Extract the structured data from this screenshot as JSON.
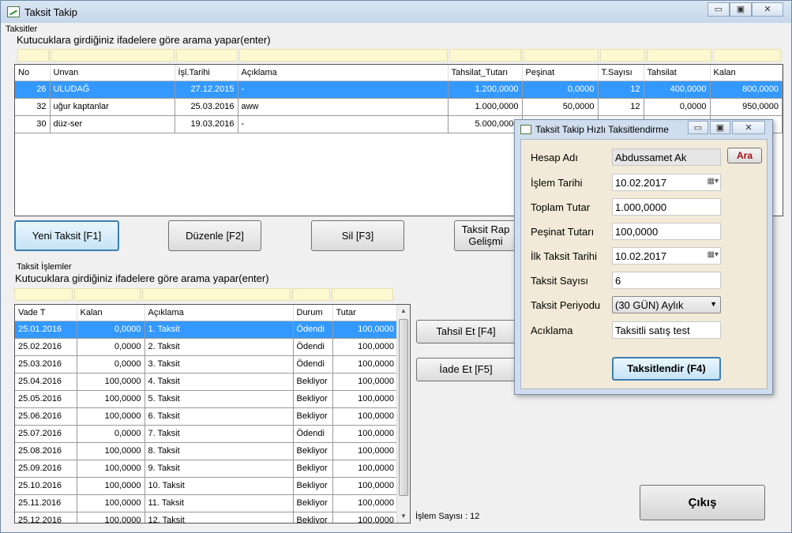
{
  "window": {
    "title": "Taksit Takip",
    "min": "▭",
    "max": "▣",
    "close": "✕"
  },
  "top": {
    "group_label": "Taksitler",
    "hint": "Kutucuklara girdiğiniz ifadelere göre arama yapar(enter)",
    "columns": [
      "No",
      "Unvan",
      "İşl.Tarihi",
      "Açıklama",
      "Tahsilat_Tutarı",
      "Peşinat",
      "T.Sayısı",
      "Tahsilat",
      "Kalan"
    ],
    "rows": [
      [
        "26",
        "ULUDAĞ",
        "27.12.2015",
        "-",
        "1.200,0000",
        "0,0000",
        "12",
        "400,0000",
        "800,0000"
      ],
      [
        "32",
        "uğur kaptanlar",
        "25.03.2016",
        "aww",
        "1.000,0000",
        "50,0000",
        "12",
        "0,0000",
        "950,0000"
      ],
      [
        "30",
        "düz-ser",
        "19.03.2016",
        "-",
        "5.000,0000",
        "",
        "",
        "",
        ""
      ]
    ]
  },
  "buttons": {
    "new": "Yeni Taksit [F1]",
    "edit": "Düzenle [F2]",
    "delete": "Sil [F3]",
    "report1": "Taksit Rap",
    "report2": "Gelişmi",
    "collect": "Tahsil Et [F4]",
    "refund": "İade Et [F5]",
    "exit": "Çıkış"
  },
  "bottom": {
    "group_label": "Taksit İşlemler",
    "hint": "Kutucuklara girdiğiniz ifadelere göre arama yapar(enter)",
    "columns": [
      "Vade T",
      "Kalan",
      "Açıklama",
      "Durum",
      "Tutar"
    ],
    "rows": [
      [
        "25.01.2016",
        "0,0000",
        "1. Taksit",
        "Ödendi",
        "100,0000"
      ],
      [
        "25.02.2016",
        "0,0000",
        "2. Taksit",
        "Ödendi",
        "100,0000"
      ],
      [
        "25.03.2016",
        "0,0000",
        "3. Taksit",
        "Ödendi",
        "100,0000"
      ],
      [
        "25.04.2016",
        "100,0000",
        "4. Taksit",
        "Bekliyor",
        "100,0000"
      ],
      [
        "25.05.2016",
        "100,0000",
        "5. Taksit",
        "Bekliyor",
        "100,0000"
      ],
      [
        "25.06.2016",
        "100,0000",
        "6. Taksit",
        "Bekliyor",
        "100,0000"
      ],
      [
        "25.07.2016",
        "0,0000",
        "7. Taksit",
        "Ödendi",
        "100,0000"
      ],
      [
        "25.08.2016",
        "100,0000",
        "8. Taksit",
        "Bekliyor",
        "100,0000"
      ],
      [
        "25.09.2016",
        "100,0000",
        "9. Taksit",
        "Bekliyor",
        "100,0000"
      ],
      [
        "25.10.2016",
        "100,0000",
        "10. Taksit",
        "Bekliyor",
        "100,0000"
      ],
      [
        "25.11.2016",
        "100,0000",
        "11. Taksit",
        "Bekliyor",
        "100,0000"
      ],
      [
        "25.12.2016",
        "100,0000",
        "12. Taksit",
        "Bekliyor",
        "100,0000"
      ]
    ],
    "count_label": "İşlem Sayısı : 12"
  },
  "dialog": {
    "title": "Taksit Takip Hızlı Taksitlendirme",
    "fields": {
      "hesap_label": "Hesap Adı",
      "hesap_value": "Abdussamet Ak",
      "ara": "Ara",
      "islem_label": "İşlem Tarihi",
      "islem_value": "10.02.2017",
      "toplam_label": "Toplam Tutar",
      "toplam_value": "1.000,0000",
      "pesinat_label": "Peşinat Tutarı",
      "pesinat_value": "100,0000",
      "ilk_label": "İlk Taksit Tarihi",
      "ilk_value": "10.02.2017",
      "sayi_label": "Taksit Sayısı",
      "sayi_value": "6",
      "periyot_label": "Taksit Periyodu",
      "periyot_value": "(30 GÜN) Aylık",
      "aciklama_label": "Acıklama",
      "aciklama_value": "Taksitli satış test"
    },
    "submit": "Taksitlendir (F4)"
  }
}
